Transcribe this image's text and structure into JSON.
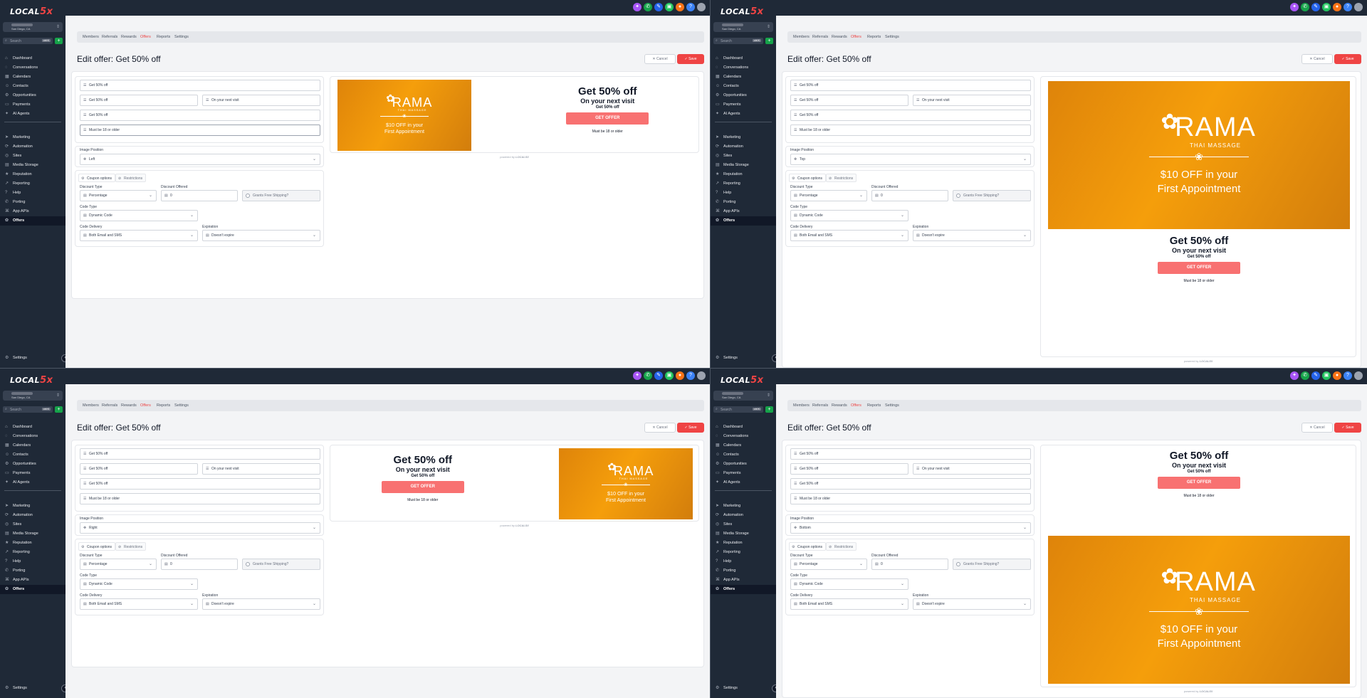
{
  "app": {
    "logo_text": "LOCAL",
    "logo_accent": "5x",
    "location_city": "San Diego, CA"
  },
  "sidebar": {
    "search_placeholder": "Search",
    "search_shortcut": "ctrl K",
    "add_label": "+",
    "items": [
      {
        "label": "Dashboard",
        "icon": "dashboard-icon",
        "glyph": "⌂"
      },
      {
        "label": "Conversations",
        "icon": "chat-icon",
        "glyph": "◌"
      },
      {
        "label": "Calendars",
        "icon": "calendar-icon",
        "glyph": "▦"
      },
      {
        "label": "Contacts",
        "icon": "contacts-icon",
        "glyph": "☺"
      },
      {
        "label": "Opportunities",
        "icon": "opportunities-icon",
        "glyph": "⚙"
      },
      {
        "label": "Payments",
        "icon": "payments-icon",
        "glyph": "▭"
      },
      {
        "label": "AI Agents",
        "icon": "ai-agents-icon",
        "glyph": "✦"
      },
      {
        "label": "Marketing",
        "icon": "marketing-icon",
        "glyph": "➤"
      },
      {
        "label": "Automation",
        "icon": "automation-icon",
        "glyph": "⟳"
      },
      {
        "label": "Sites",
        "icon": "sites-icon",
        "glyph": "◎"
      },
      {
        "label": "Media Storage",
        "icon": "media-icon",
        "glyph": "▤"
      },
      {
        "label": "Reputation",
        "icon": "reputation-icon",
        "glyph": "★"
      },
      {
        "label": "Reporting",
        "icon": "reporting-icon",
        "glyph": "↗"
      },
      {
        "label": "Help",
        "icon": "help-icon",
        "glyph": "?"
      },
      {
        "label": "Porting",
        "icon": "porting-icon",
        "glyph": "✆"
      },
      {
        "label": "App APIs",
        "icon": "api-icon",
        "glyph": "⌘"
      },
      {
        "label": "Offers",
        "icon": "offers-icon",
        "glyph": "✿"
      }
    ],
    "settings_label": "Settings",
    "collapse_glyph": "‹"
  },
  "topbar": {
    "icons": [
      {
        "name": "ai-assistant-icon",
        "glyph": "✦",
        "color": "#a855f7"
      },
      {
        "name": "phone-icon",
        "glyph": "✆",
        "color": "#16a34a"
      },
      {
        "name": "edit-icon",
        "glyph": "✎",
        "color": "#2563eb"
      },
      {
        "name": "gift-icon",
        "glyph": "▣",
        "color": "#22c55e"
      },
      {
        "name": "notifications-icon",
        "glyph": "●",
        "color": "#f97316"
      },
      {
        "name": "help-circle-icon",
        "glyph": "?",
        "color": "#3b82f6"
      },
      {
        "name": "avatar",
        "glyph": "",
        "color": "#9ca3af"
      }
    ]
  },
  "tabs": [
    "Members",
    "Referrals",
    "Rewards",
    "Offers",
    "Reports",
    "Settings"
  ],
  "active_tab": "Offers",
  "page": {
    "title": "Edit offer: Get 50% off",
    "cancel_label": "Cancel",
    "save_label": "Save"
  },
  "form": {
    "title_value": "Get 50% off",
    "subtitle1_value": "Get 50% off",
    "subtitle2_value": "On your next visit",
    "button_value": "Get 50% off",
    "disclaimer_value": "Must be 18 or older",
    "image_position_label": "Image Position",
    "coupon_options_label": "Coupon options",
    "restrictions_label": "Restrictions",
    "discount_type_label": "Discount Type",
    "discount_type_value": "Percentage",
    "discount_offered_label": "Discount Offered",
    "discount_offered_value": "0",
    "free_shipping_label": "Grants Free Shipping?",
    "code_type_label": "Code Type",
    "code_type_value": "Dynamic Code",
    "code_delivery_label": "Code Delivery",
    "code_delivery_value": "Both Email and SMS",
    "expiration_label": "Expiration",
    "expiration_value": "Doesn't expire"
  },
  "preview": {
    "headline": "Get 50% off",
    "subheadline": "On your next visit",
    "small_line": "Get 50% off",
    "button": "GET OFFER",
    "note": "Must be 18 or older",
    "brand": "RAMA",
    "brand_sub": "THAI MASSAGE",
    "offer_line1": "$10 OFF in your",
    "offer_line2": "First Appointment",
    "powered_by": "powered by",
    "powered_logo": "LOCAL5X"
  },
  "panels": [
    {
      "position_value": "Left"
    },
    {
      "position_value": "Top"
    },
    {
      "position_value": "Right"
    },
    {
      "position_value": "Bottom"
    }
  ],
  "colors": {
    "accent": "#ef4444",
    "sidebar": "#1f2937",
    "promo_orange": "#f59e0b"
  }
}
